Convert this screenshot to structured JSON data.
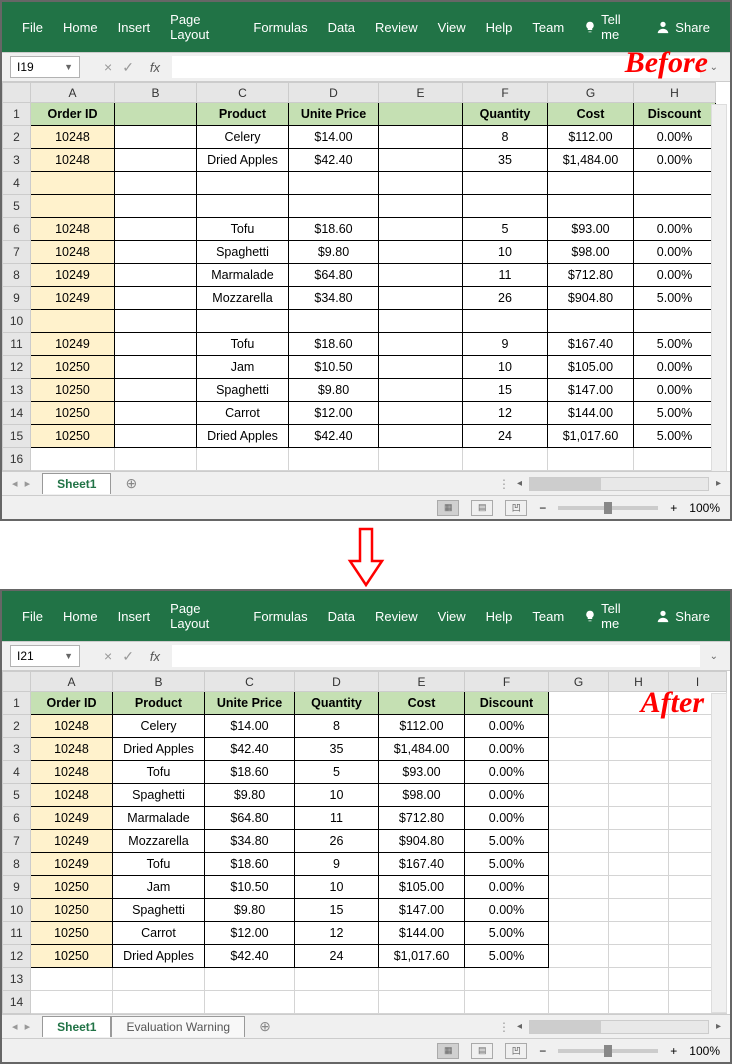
{
  "labels": {
    "before": "Before",
    "after": "After"
  },
  "menu": [
    "File",
    "Home",
    "Insert",
    "Page Layout",
    "Formulas",
    "Data",
    "Review",
    "View",
    "Help",
    "Team"
  ],
  "tellme": "Tell me",
  "share": "Share",
  "namebox": {
    "before": "I19",
    "after": "I21"
  },
  "fx": "fx",
  "zoom": "100%",
  "sheets": {
    "main": "Sheet1",
    "eval": "Evaluation Warning"
  },
  "before": {
    "cols": [
      "A",
      "B",
      "C",
      "D",
      "E",
      "F",
      "G",
      "H"
    ],
    "headers": {
      "A": "Order ID",
      "B": "",
      "C": "Product",
      "D": "Unite Price",
      "E": "",
      "F": "Quantity",
      "G": "Cost",
      "H": "Discount"
    },
    "rows": [
      {
        "n": "1",
        "type": "header"
      },
      {
        "n": "2",
        "A": "10248",
        "C": "Celery",
        "D": "$14.00",
        "F": "8",
        "G": "$112.00",
        "H": "0.00%"
      },
      {
        "n": "3",
        "A": "10248",
        "C": "Dried Apples",
        "D": "$42.40",
        "F": "35",
        "G": "$1,484.00",
        "H": "0.00%"
      },
      {
        "n": "4",
        "blank": true
      },
      {
        "n": "5",
        "blank": true
      },
      {
        "n": "6",
        "A": "10248",
        "C": "Tofu",
        "D": "$18.60",
        "F": "5",
        "G": "$93.00",
        "H": "0.00%"
      },
      {
        "n": "7",
        "A": "10248",
        "C": "Spaghetti",
        "D": "$9.80",
        "F": "10",
        "G": "$98.00",
        "H": "0.00%"
      },
      {
        "n": "8",
        "A": "10249",
        "C": "Marmalade",
        "D": "$64.80",
        "F": "11",
        "G": "$712.80",
        "H": "0.00%"
      },
      {
        "n": "9",
        "A": "10249",
        "C": "Mozzarella",
        "D": "$34.80",
        "F": "26",
        "G": "$904.80",
        "H": "5.00%"
      },
      {
        "n": "10",
        "blank": true
      },
      {
        "n": "11",
        "A": "10249",
        "C": "Tofu",
        "D": "$18.60",
        "F": "9",
        "G": "$167.40",
        "H": "5.00%"
      },
      {
        "n": "12",
        "A": "10250",
        "C": "Jam",
        "D": "$10.50",
        "F": "10",
        "G": "$105.00",
        "H": "0.00%"
      },
      {
        "n": "13",
        "A": "10250",
        "C": "Spaghetti",
        "D": "$9.80",
        "F": "15",
        "G": "$147.00",
        "H": "0.00%"
      },
      {
        "n": "14",
        "A": "10250",
        "C": "Carrot",
        "D": "$12.00",
        "F": "12",
        "G": "$144.00",
        "H": "5.00%"
      },
      {
        "n": "15",
        "A": "10250",
        "C": "Dried Apples",
        "D": "$42.40",
        "F": "24",
        "G": "$1,017.60",
        "H": "5.00%"
      },
      {
        "n": "16",
        "outside": true
      }
    ]
  },
  "after": {
    "cols": [
      "A",
      "B",
      "C",
      "D",
      "E",
      "F",
      "G",
      "H",
      "I"
    ],
    "headers": {
      "A": "Order ID",
      "B": "Product",
      "C": "Unite Price",
      "D": "Quantity",
      "E": "Cost",
      "F": "Discount"
    },
    "rows": [
      {
        "n": "1",
        "type": "header"
      },
      {
        "n": "2",
        "A": "10248",
        "B": "Celery",
        "C": "$14.00",
        "D": "8",
        "E": "$112.00",
        "F": "0.00%"
      },
      {
        "n": "3",
        "A": "10248",
        "B": "Dried Apples",
        "C": "$42.40",
        "D": "35",
        "E": "$1,484.00",
        "F": "0.00%"
      },
      {
        "n": "4",
        "A": "10248",
        "B": "Tofu",
        "C": "$18.60",
        "D": "5",
        "E": "$93.00",
        "F": "0.00%"
      },
      {
        "n": "5",
        "A": "10248",
        "B": "Spaghetti",
        "C": "$9.80",
        "D": "10",
        "E": "$98.00",
        "F": "0.00%"
      },
      {
        "n": "6",
        "A": "10249",
        "B": "Marmalade",
        "C": "$64.80",
        "D": "11",
        "E": "$712.80",
        "F": "0.00%"
      },
      {
        "n": "7",
        "A": "10249",
        "B": "Mozzarella",
        "C": "$34.80",
        "D": "26",
        "E": "$904.80",
        "F": "5.00%"
      },
      {
        "n": "8",
        "A": "10249",
        "B": "Tofu",
        "C": "$18.60",
        "D": "9",
        "E": "$167.40",
        "F": "5.00%"
      },
      {
        "n": "9",
        "A": "10250",
        "B": "Jam",
        "C": "$10.50",
        "D": "10",
        "E": "$105.00",
        "F": "0.00%"
      },
      {
        "n": "10",
        "A": "10250",
        "B": "Spaghetti",
        "C": "$9.80",
        "D": "15",
        "E": "$147.00",
        "F": "0.00%"
      },
      {
        "n": "11",
        "A": "10250",
        "B": "Carrot",
        "C": "$12.00",
        "D": "12",
        "E": "$144.00",
        "F": "5.00%"
      },
      {
        "n": "12",
        "A": "10250",
        "B": "Dried Apples",
        "C": "$42.40",
        "D": "24",
        "E": "$1,017.60",
        "F": "5.00%"
      },
      {
        "n": "13",
        "outside": true
      },
      {
        "n": "14",
        "outside": true
      }
    ]
  }
}
